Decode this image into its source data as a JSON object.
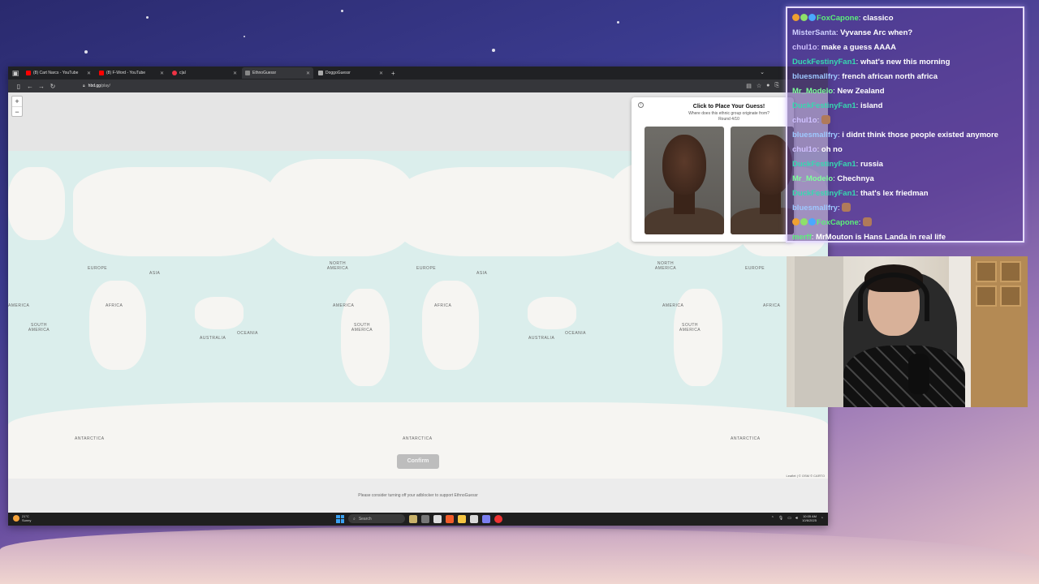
{
  "browser": {
    "tabs": [
      {
        "label": "(8) Cart Narcs - YouTube",
        "icon": "youtube-icon",
        "active": false
      },
      {
        "label": "(8) F-Word - YouTube",
        "icon": "youtube-icon",
        "active": false
      },
      {
        "label": "c|al",
        "icon": "clock-icon",
        "active": false
      },
      {
        "label": "EthnoGuessr",
        "icon": "page-icon",
        "active": true
      },
      {
        "label": "DoggoGuessr",
        "icon": "page-icon",
        "active": false
      }
    ],
    "url_host": "hbd.gg",
    "url_path": "/play/"
  },
  "map": {
    "labels": [
      {
        "text": "EUROPE"
      },
      {
        "text": "ASIA"
      },
      {
        "text": "AFRICA"
      },
      {
        "text": "NORTH AMERICA"
      },
      {
        "text": "SOUTH AMERICA"
      },
      {
        "text": "AUSTRALIA"
      },
      {
        "text": "OCEANIA"
      },
      {
        "text": "ANTARCTICA"
      }
    ],
    "zoom_in": "+",
    "zoom_out": "−",
    "attribution": "Leaflet | © OSM © CARTO"
  },
  "guess_panel": {
    "title": "Click to Place Your Guess!",
    "subtitle": "Where does this ethnic group originate from?",
    "round": "Round 4/10"
  },
  "confirm_label": "Confirm",
  "adblock_message": "Please consider turning off your adblocker to support EthnoGuessr",
  "taskbar": {
    "weather_temp": "21°C",
    "weather_desc": "Sunny",
    "search_placeholder": "Search",
    "time": "10:05 AM",
    "date": "10/6/2025"
  },
  "chat": {
    "messages": [
      {
        "user": "FoxCapone",
        "color": "#5cf07a",
        "text": "classico",
        "badges": true
      },
      {
        "user": "MisterSanta",
        "color": "#cfd0ff",
        "text": "Vyvanse Arc when?"
      },
      {
        "user": "chul1o",
        "color": "#cfc0ff",
        "text": "make a guess AAAA"
      },
      {
        "user": "DuckFestinyFan1",
        "color": "#36d9b0",
        "text": "what's new this morning"
      },
      {
        "user": "bluesmallfry",
        "color": "#9ec8ff",
        "text": "french african north africa"
      },
      {
        "user": "Mr_Modelo",
        "color": "#7dff9b",
        "text": "New Zealand"
      },
      {
        "user": "DuckFestinyFan1",
        "color": "#36d9b0",
        "text": "island"
      },
      {
        "user": "chul1o",
        "color": "#cfc0ff",
        "text": "",
        "emote": true
      },
      {
        "user": "bluesmallfry",
        "color": "#9ec8ff",
        "text": "i didnt think those people existed anymore"
      },
      {
        "user": "chul1o",
        "color": "#cfc0ff",
        "text": "oh no"
      },
      {
        "user": "DuckFestinyFan1",
        "color": "#36d9b0",
        "text": "russia"
      },
      {
        "user": "Mr_Modelo",
        "color": "#7dff9b",
        "text": "Chechnya"
      },
      {
        "user": "DuckFestinyFan1",
        "color": "#36d9b0",
        "text": "that's lex friedman"
      },
      {
        "user": "bluesmallfry",
        "color": "#9ec8ff",
        "text": "",
        "emote": true
      },
      {
        "user": "FoxCapone",
        "color": "#5cf07a",
        "text": "",
        "badges": true,
        "emote": true
      },
      {
        "user": "merff",
        "color": "#5cf07a",
        "text": "MrMouton is Hans Landa in real life"
      }
    ]
  }
}
